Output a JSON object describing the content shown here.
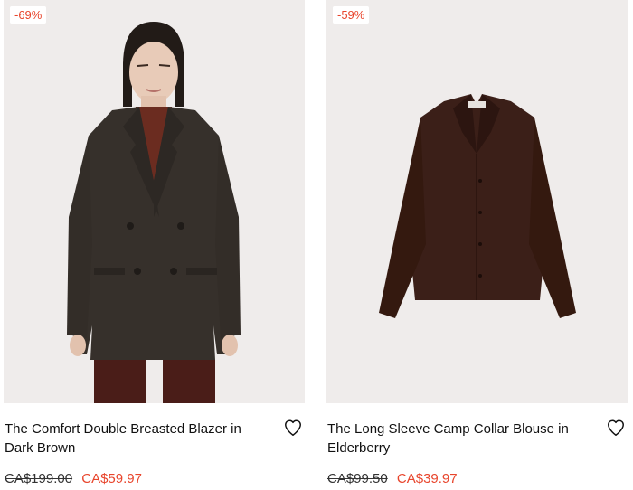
{
  "products": [
    {
      "badge": "-69%",
      "title": "The Comfort Double Breasted Blazer in Dark Brown",
      "price_original": "CA$199.00",
      "price_sale": "CA$59.97",
      "image": "model-wearing-dark-brown-blazer"
    },
    {
      "badge": "-59%",
      "title": "The Long Sleeve Camp Collar Blouse in Elderberry",
      "price_original": "CA$99.50",
      "price_sale": "CA$39.97",
      "image": "elderberry-blouse-flat-lay"
    }
  ],
  "icons": {
    "wishlist": "heart-outline-icon"
  },
  "colors": {
    "sale": "#e8452c",
    "image_bg": "#efeceb"
  }
}
